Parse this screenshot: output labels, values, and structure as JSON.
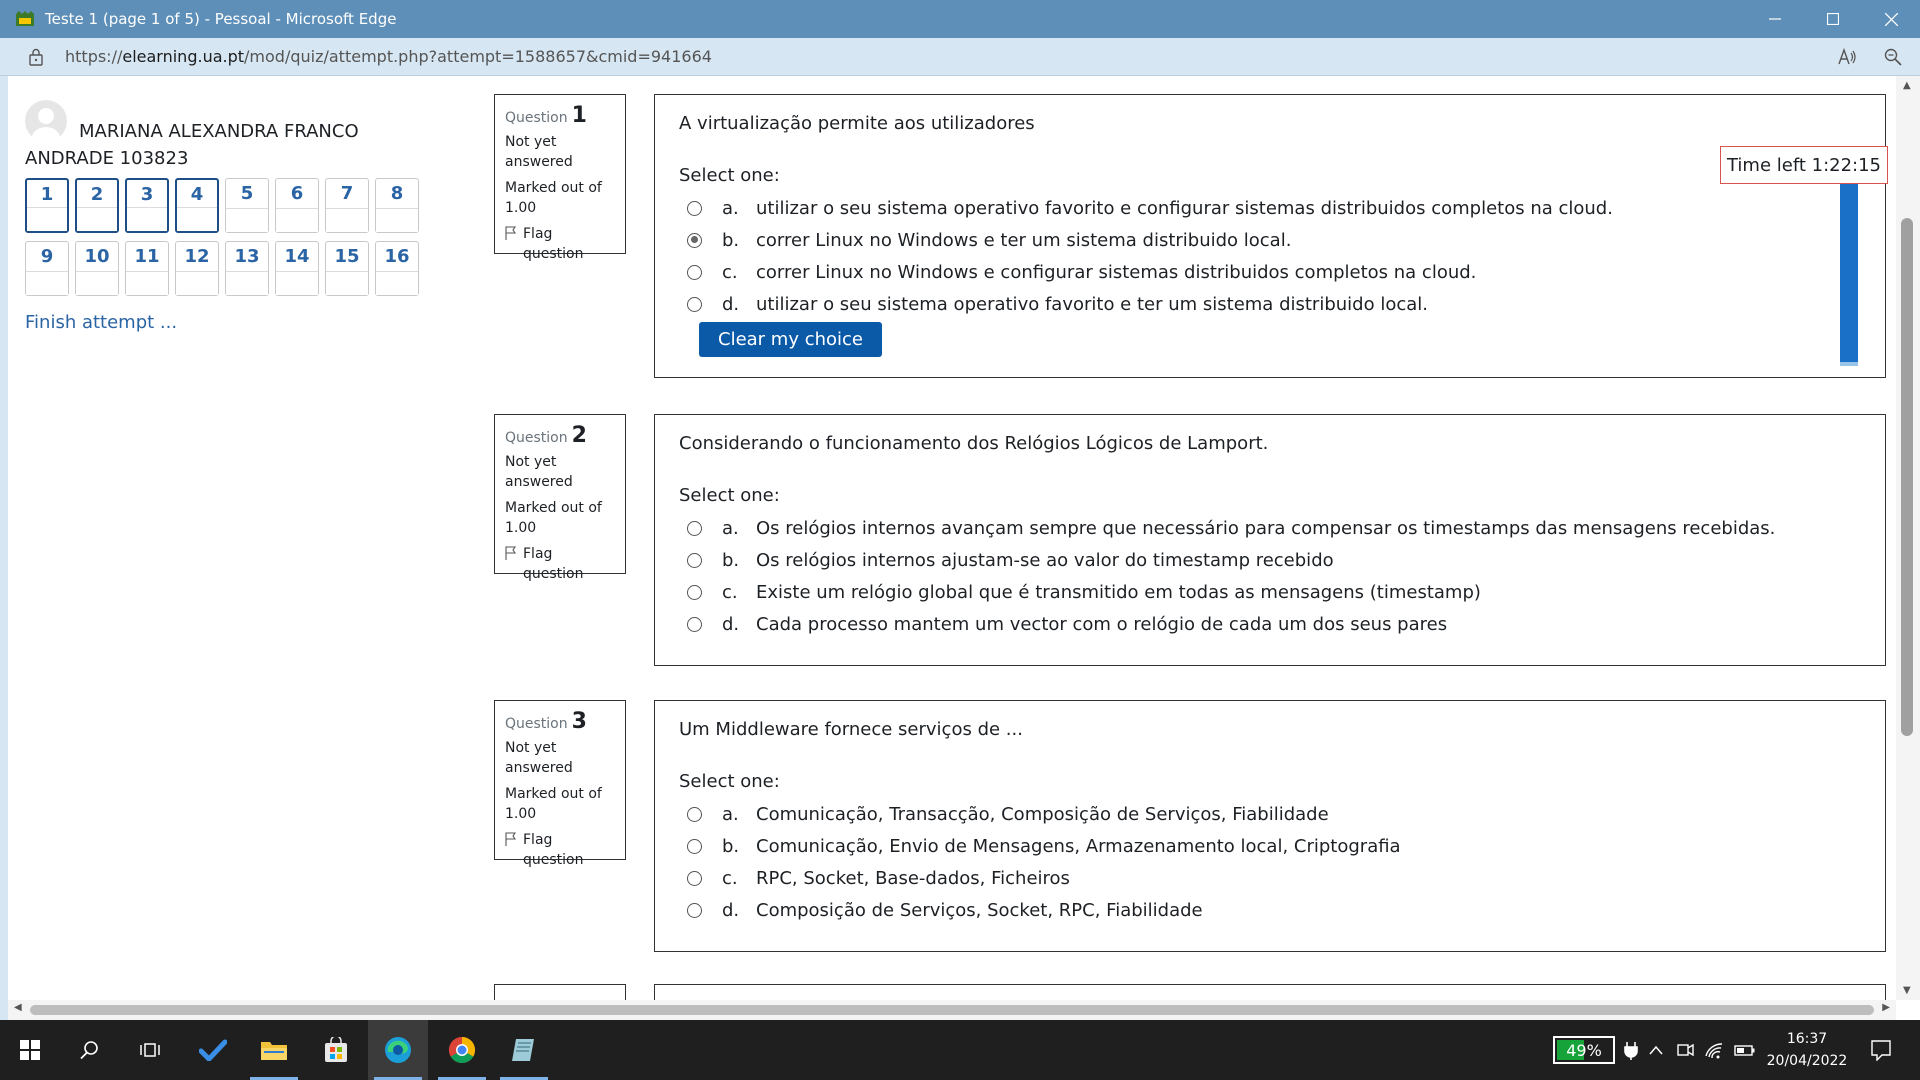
{
  "window": {
    "title": "Teste 1 (page 1 of 5) - Pessoal - Microsoft Edge",
    "url_prefix": "https://",
    "url_domain": "elearning.ua.pt",
    "url_path": "/mod/quiz/attempt.php?attempt=1588657&cmid=941664"
  },
  "user": {
    "name": "MARIANA ALEXANDRA FRANCO ANDRADE 103823"
  },
  "nav": {
    "buttons": [
      "1",
      "2",
      "3",
      "4",
      "5",
      "6",
      "7",
      "8",
      "9",
      "10",
      "11",
      "12",
      "13",
      "14",
      "15",
      "16"
    ],
    "finish_label": "Finish attempt ..."
  },
  "timer": {
    "label": "Time left 1:22:15"
  },
  "questions": [
    {
      "label": "Question",
      "number": "1",
      "state": "Not yet answered",
      "grade": "Marked out of 1.00",
      "flag": "Flag question",
      "text": "A virtualização permite aos utilizadores",
      "prompt": "Select one:",
      "answers": [
        {
          "letter": "a.",
          "text": "utilizar o seu sistema operativo favorito e configurar sistemas distribuidos completos na cloud."
        },
        {
          "letter": "b.",
          "text": "correr Linux no Windows e ter um sistema distribuido local."
        },
        {
          "letter": "c.",
          "text": "correr Linux no Windows e configurar sistemas distribuidos completos na cloud."
        },
        {
          "letter": "d.",
          "text": "utilizar o seu sistema operativo favorito e ter um sistema distribuido local."
        }
      ],
      "selected": "b.",
      "clear_label": "Clear my choice"
    },
    {
      "label": "Question",
      "number": "2",
      "state": "Not yet answered",
      "grade": "Marked out of 1.00",
      "flag": "Flag question",
      "text": "Considerando o funcionamento dos Relógios Lógicos de Lamport.",
      "prompt": "Select one:",
      "answers": [
        {
          "letter": "a.",
          "text": "Os relógios internos avançam sempre que necessário para compensar os timestamps das mensagens recebidas."
        },
        {
          "letter": "b.",
          "text": "Os relógios internos ajustam-se ao valor do timestamp recebido"
        },
        {
          "letter": "c.",
          "text": "Existe um relógio global que é transmitido em todas as mensagens (timestamp)"
        },
        {
          "letter": "d.",
          "text": "Cada processo mantem um vector com o relógio de cada um dos seus pares"
        }
      ]
    },
    {
      "label": "Question",
      "number": "3",
      "state": "Not yet answered",
      "grade": "Marked out of 1.00",
      "flag": "Flag question",
      "text": "Um Middleware fornece serviços de ...",
      "prompt": "Select one:",
      "answers": [
        {
          "letter": "a.",
          "text": "Comunicação, Transacção, Composição de Serviços, Fiabilidade"
        },
        {
          "letter": "b.",
          "text": "Comunicação, Envio de Mensagens, Armazenamento local, Criptografia"
        },
        {
          "letter": "c.",
          "text": "RPC, Socket, Base-dados, Ficheiros"
        },
        {
          "letter": "d.",
          "text": "Composição de Serviços, Socket, RPC, Fiabilidade"
        }
      ]
    }
  ],
  "taskbar": {
    "battery": "49%",
    "time": "16:37",
    "date": "20/04/2022"
  },
  "colors": {
    "titlebar": "#5d8fb8",
    "addressbar": "#d6e6f2",
    "link": "#2a64a4",
    "button": "#0b5aa8",
    "timer_bar": "#1a6fc6",
    "taskbar": "#1f1f1f"
  }
}
